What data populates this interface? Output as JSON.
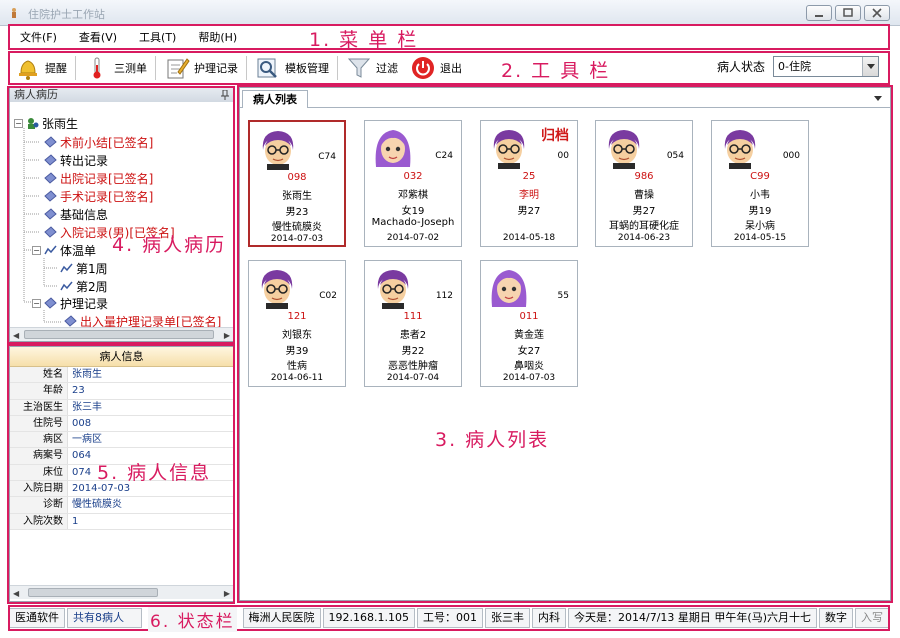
{
  "window": {
    "title": "住院护士工作站"
  },
  "menu": {
    "items": [
      "文件(F)",
      "查看(V)",
      "工具(T)",
      "帮助(H)"
    ],
    "annotation": "1. 菜 单 栏"
  },
  "toolbar": {
    "buttons": [
      "提醒",
      "三测单",
      "护理记录",
      "模板管理",
      "过滤",
      "退出"
    ],
    "annotation": "2. 工 具 栏",
    "status_label": "病人状态",
    "status_value": "0-住院"
  },
  "record_tree": {
    "pane_title": "病人病历",
    "root": "张雨生",
    "items": [
      "术前小结[已签名]",
      "转出记录",
      "出院记录[已签名]",
      "手术记录[已签名]",
      "基础信息",
      "入院记录(男)[已签名]",
      "体温单",
      "第1周",
      "第2周",
      "护理记录",
      "出入量护理记录单[已签名]"
    ],
    "annotation": "4. 病人病历"
  },
  "patient_info": {
    "header": "病人信息",
    "fields": [
      {
        "label": "姓名",
        "value": "张雨生"
      },
      {
        "label": "年龄",
        "value": "23"
      },
      {
        "label": "主治医生",
        "value": "张三丰"
      },
      {
        "label": "住院号",
        "value": "008"
      },
      {
        "label": "病区",
        "value": "一病区"
      },
      {
        "label": "病案号",
        "value": "064"
      },
      {
        "label": "床位",
        "value": "074"
      },
      {
        "label": "入院日期",
        "value": "2014-07-03"
      },
      {
        "label": "诊断",
        "value": "慢性硫膜炎"
      },
      {
        "label": "入院次数",
        "value": "1"
      }
    ],
    "annotation": "5. 病人信息"
  },
  "patient_list": {
    "tab": "病人列表",
    "annotation": "3. 病人列表",
    "cards": [
      {
        "bed": "C74",
        "no": "098",
        "name": "张雨生",
        "sex_age": "男23",
        "diagnosis": "慢性硫膜炎",
        "date": "2014-07-03",
        "avatar": "male",
        "selected": true
      },
      {
        "bed": "C24",
        "no": "032",
        "name": "邓紫棋",
        "sex_age": "女19",
        "diagnosis": "Machado-Joseph",
        "date": "2014-07-02",
        "avatar": "female"
      },
      {
        "bed": "00",
        "no": "25",
        "name": "李明",
        "sex_age": "男27",
        "diagnosis": "",
        "date": "2014-05-18",
        "avatar": "male",
        "badge": "归档"
      },
      {
        "bed": "054",
        "no": "986",
        "name": "曹操",
        "sex_age": "男27",
        "diagnosis": "耳蜗的耳硬化症",
        "date": "2014-06-23",
        "avatar": "male"
      },
      {
        "bed": "000",
        "no": "C99",
        "name": "小韦",
        "sex_age": "男19",
        "diagnosis": "呆小病",
        "date": "2014-05-15",
        "avatar": "male"
      },
      {
        "bed": "C02",
        "no": "121",
        "name": "刘银东",
        "sex_age": "男39",
        "diagnosis": "性病",
        "date": "2014-06-11",
        "avatar": "male"
      },
      {
        "bed": "112",
        "no": "111",
        "name": "患者2",
        "sex_age": "男22",
        "diagnosis": "恶恶性肿瘤",
        "date": "2014-07-04",
        "avatar": "male"
      },
      {
        "bed": "55",
        "no": "011",
        "name": "黄金莲",
        "sex_age": "女27",
        "diagnosis": "鼻咽炎",
        "date": "2014-07-03",
        "avatar": "female"
      }
    ]
  },
  "statusbar": {
    "company": "医通软件",
    "count": "共有8病人",
    "annotation": "6. 状态栏",
    "hospital": "梅洲人民医院",
    "ip": "192.168.1.105",
    "staff_no": "工号：001",
    "staff_name": "张三丰",
    "department": "内科",
    "today": "今天是：2014/7/13 星期日 甲午年(马)六月十七",
    "num": "数字",
    "ins": "入写"
  }
}
